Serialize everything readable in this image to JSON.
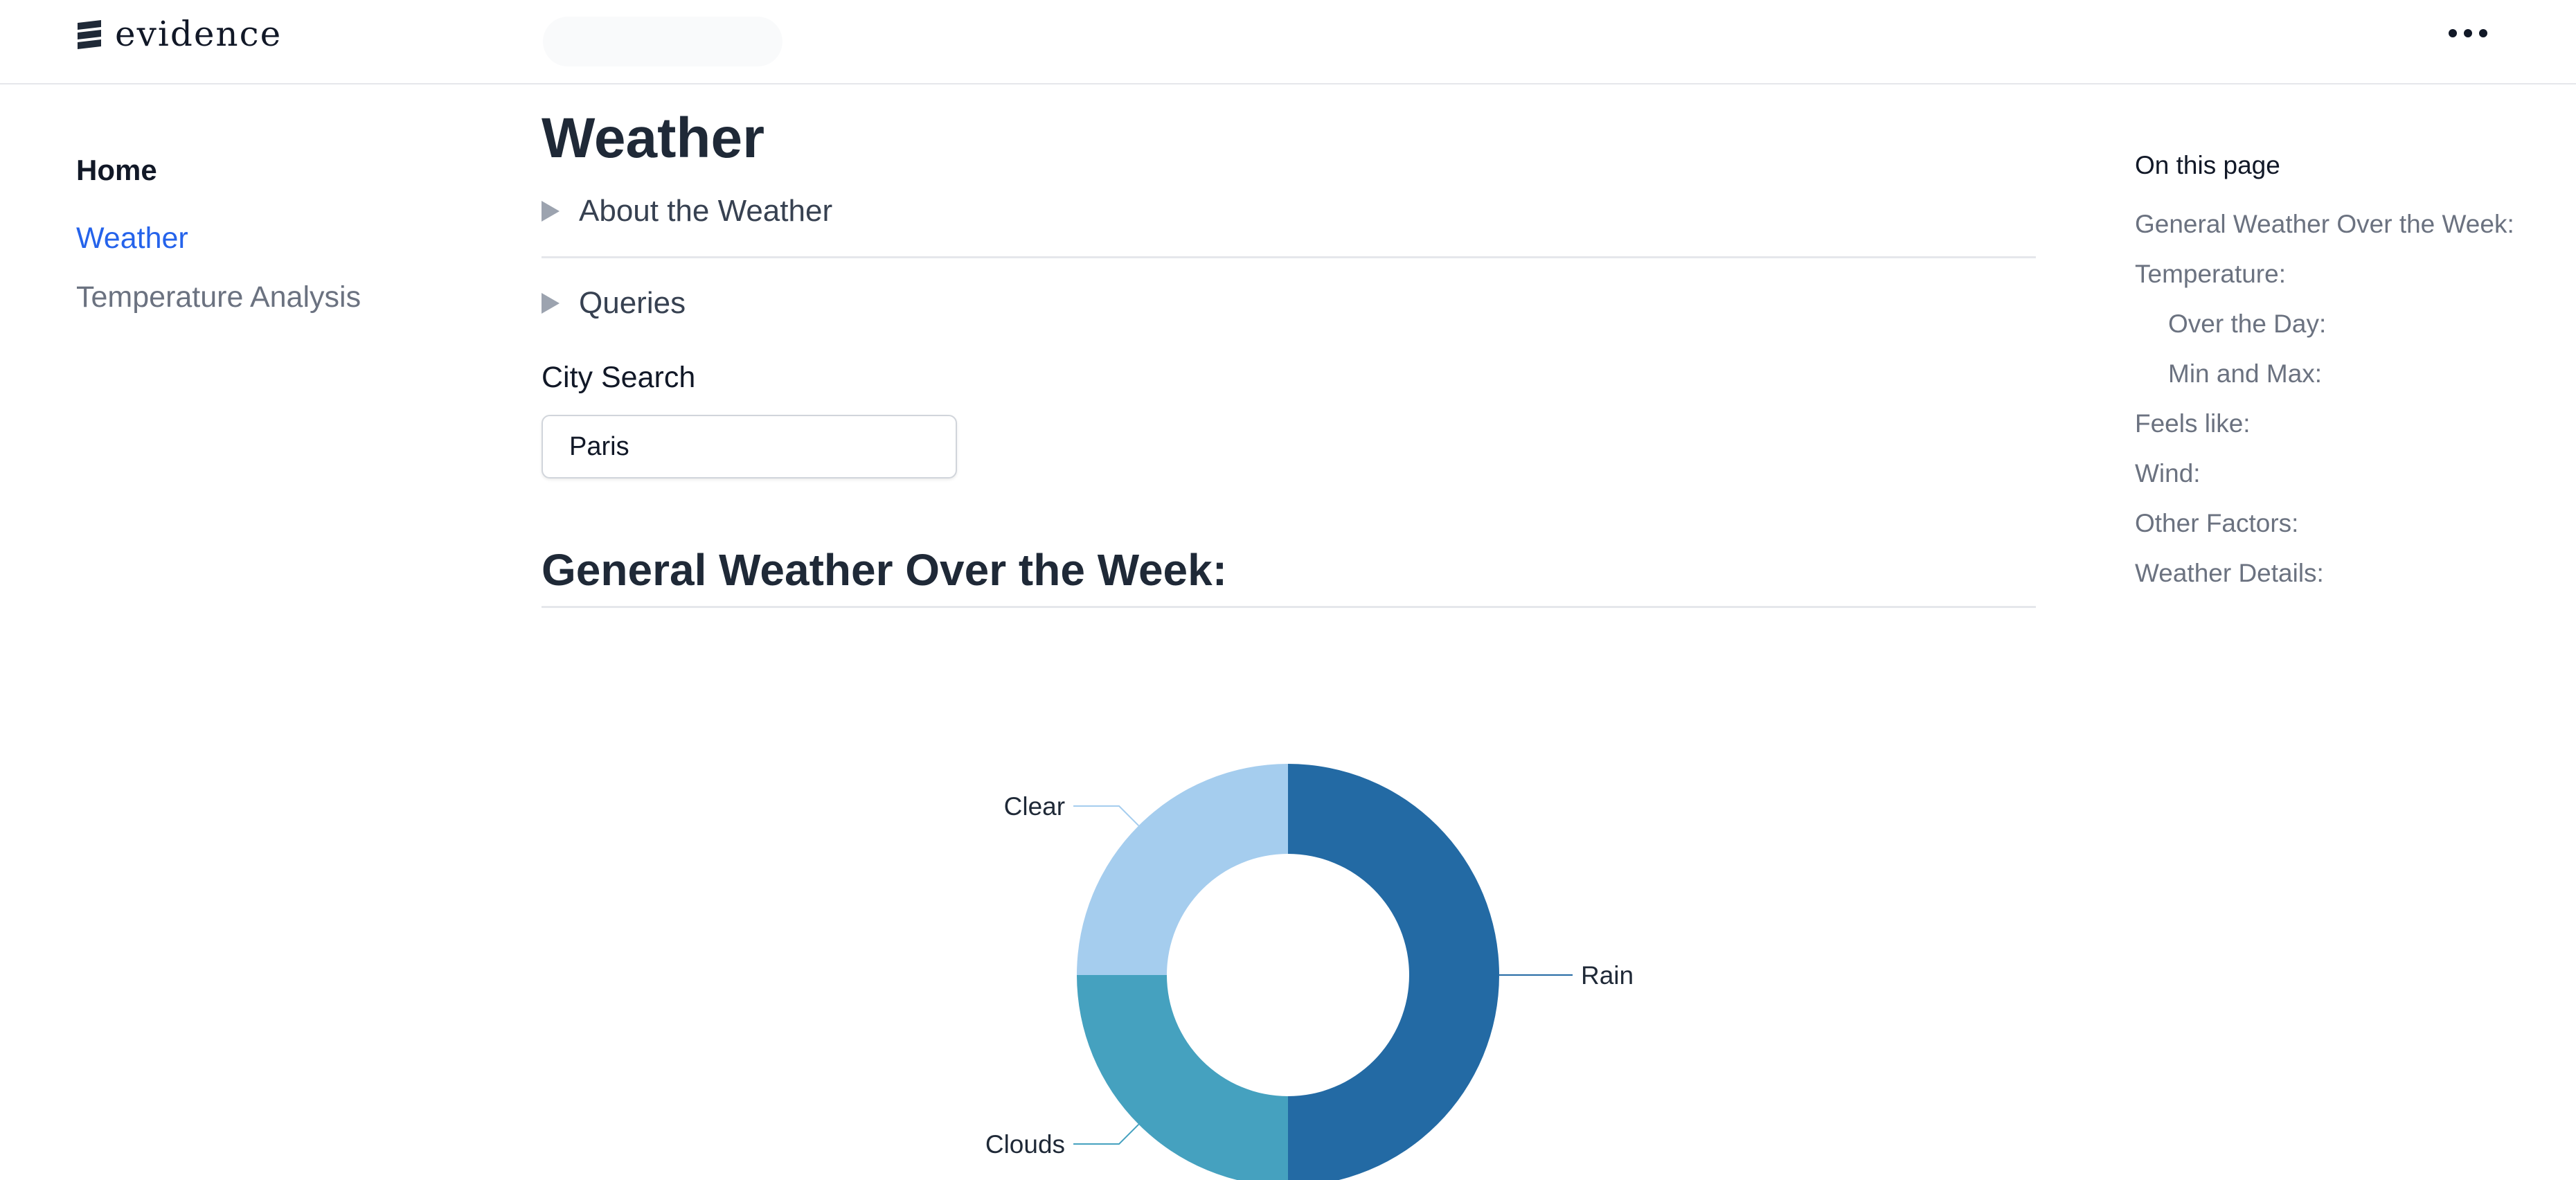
{
  "header": {
    "logo_text": "evidence",
    "menu_icon": "more-horizontal-icon"
  },
  "nav": {
    "home": "Home",
    "items": [
      {
        "label": "Weather",
        "active": true
      },
      {
        "label": "Temperature Analysis",
        "active": false
      }
    ]
  },
  "main": {
    "title": "Weather",
    "details": [
      {
        "label": "About the Weather"
      },
      {
        "label": "Queries"
      }
    ],
    "city_search": {
      "label": "City Search",
      "value": "Paris"
    },
    "section_heading": "General Weather Over the Week:"
  },
  "chart_data": {
    "type": "pie",
    "donut": true,
    "categories": [
      "Rain",
      "Clouds",
      "Clear"
    ],
    "values": [
      50,
      25,
      25
    ],
    "colors": {
      "Rain": "#236aa4",
      "Clouds": "#45a1bf",
      "Clear": "#a5cdee"
    }
  },
  "toc": {
    "title": "On this page",
    "items": [
      {
        "label": "General Weather Over the Week:",
        "level": 1
      },
      {
        "label": "Temperature:",
        "level": 1
      },
      {
        "label": "Over the Day:",
        "level": 2
      },
      {
        "label": "Min and Max:",
        "level": 2
      },
      {
        "label": "Feels like:",
        "level": 1
      },
      {
        "label": "Wind:",
        "level": 1
      },
      {
        "label": "Other Factors:",
        "level": 1
      },
      {
        "label": "Weather Details:",
        "level": 1
      }
    ]
  }
}
